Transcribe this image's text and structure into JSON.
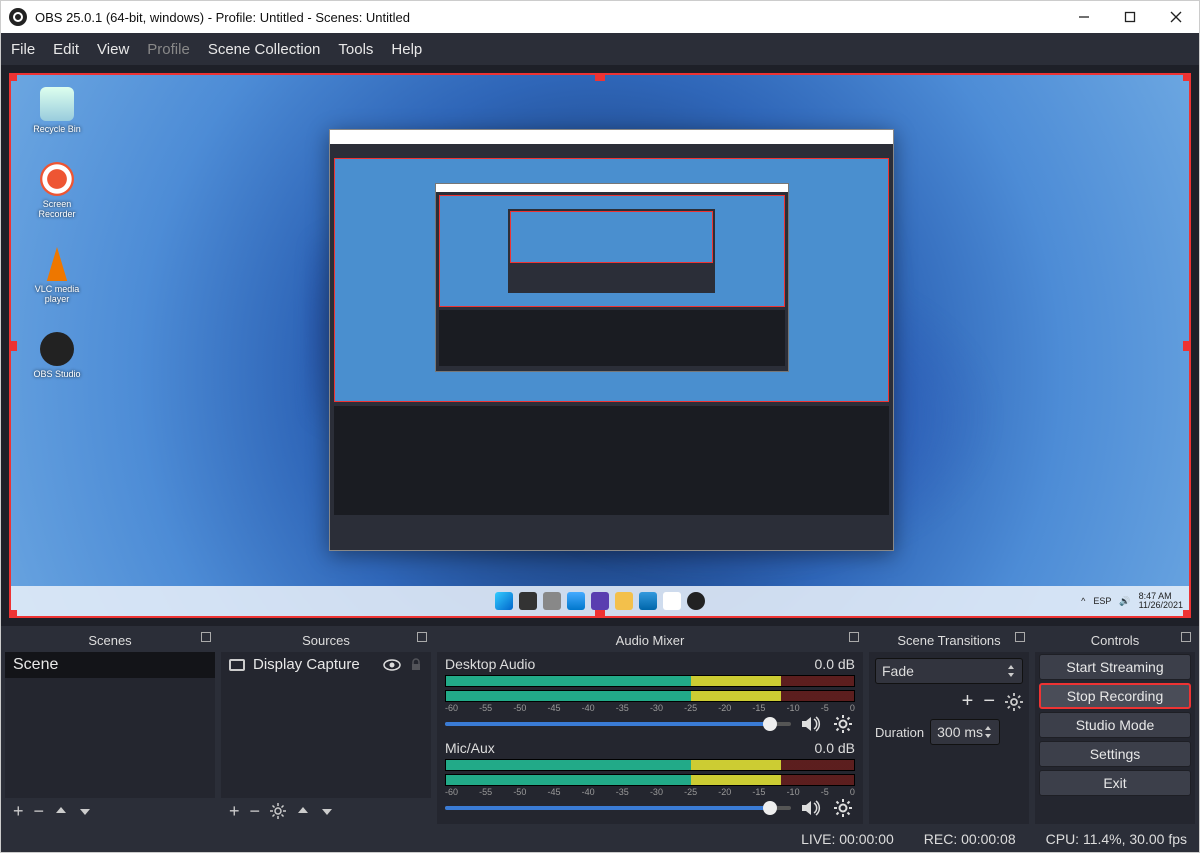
{
  "titlebar": {
    "title": "OBS 25.0.1 (64-bit, windows) - Profile: Untitled - Scenes: Untitled"
  },
  "menubar": {
    "items": [
      "File",
      "Edit",
      "View",
      "Profile",
      "Scene Collection",
      "Tools",
      "Help"
    ],
    "dimIndex": 3
  },
  "desktop": {
    "icons": [
      {
        "label": "Recycle Bin"
      },
      {
        "label": "Screen Recorder"
      },
      {
        "label": "VLC media player"
      },
      {
        "label": "OBS Studio"
      }
    ],
    "taskbarTime": "8:47 AM",
    "taskbarDate": "11/26/2021"
  },
  "panels": {
    "scenes": {
      "title": "Scenes",
      "items": [
        "Scene"
      ]
    },
    "sources": {
      "title": "Sources",
      "items": [
        {
          "name": "Display Capture"
        }
      ]
    },
    "mixer": {
      "title": "Audio Mixer",
      "channels": [
        {
          "name": "Desktop Audio",
          "db": "0.0 dB",
          "ticks": [
            "-60",
            "-55",
            "-50",
            "-45",
            "-40",
            "-35",
            "-30",
            "-25",
            "-20",
            "-15",
            "-10",
            "-5",
            "0"
          ]
        },
        {
          "name": "Mic/Aux",
          "db": "0.0 dB",
          "ticks": [
            "-60",
            "-55",
            "-50",
            "-45",
            "-40",
            "-35",
            "-30",
            "-25",
            "-20",
            "-15",
            "-10",
            "-5",
            "0"
          ]
        }
      ]
    },
    "transitions": {
      "title": "Scene Transitions",
      "current": "Fade",
      "durationLabel": "Duration",
      "duration": "300 ms"
    },
    "controls": {
      "title": "Controls",
      "buttons": [
        "Start Streaming",
        "Stop Recording",
        "Studio Mode",
        "Settings",
        "Exit"
      ],
      "highlightIndex": 1
    }
  },
  "status": {
    "live": "LIVE: 00:00:00",
    "rec": "REC: 00:00:08",
    "cpu": "CPU: 11.4%, 30.00 fps"
  }
}
